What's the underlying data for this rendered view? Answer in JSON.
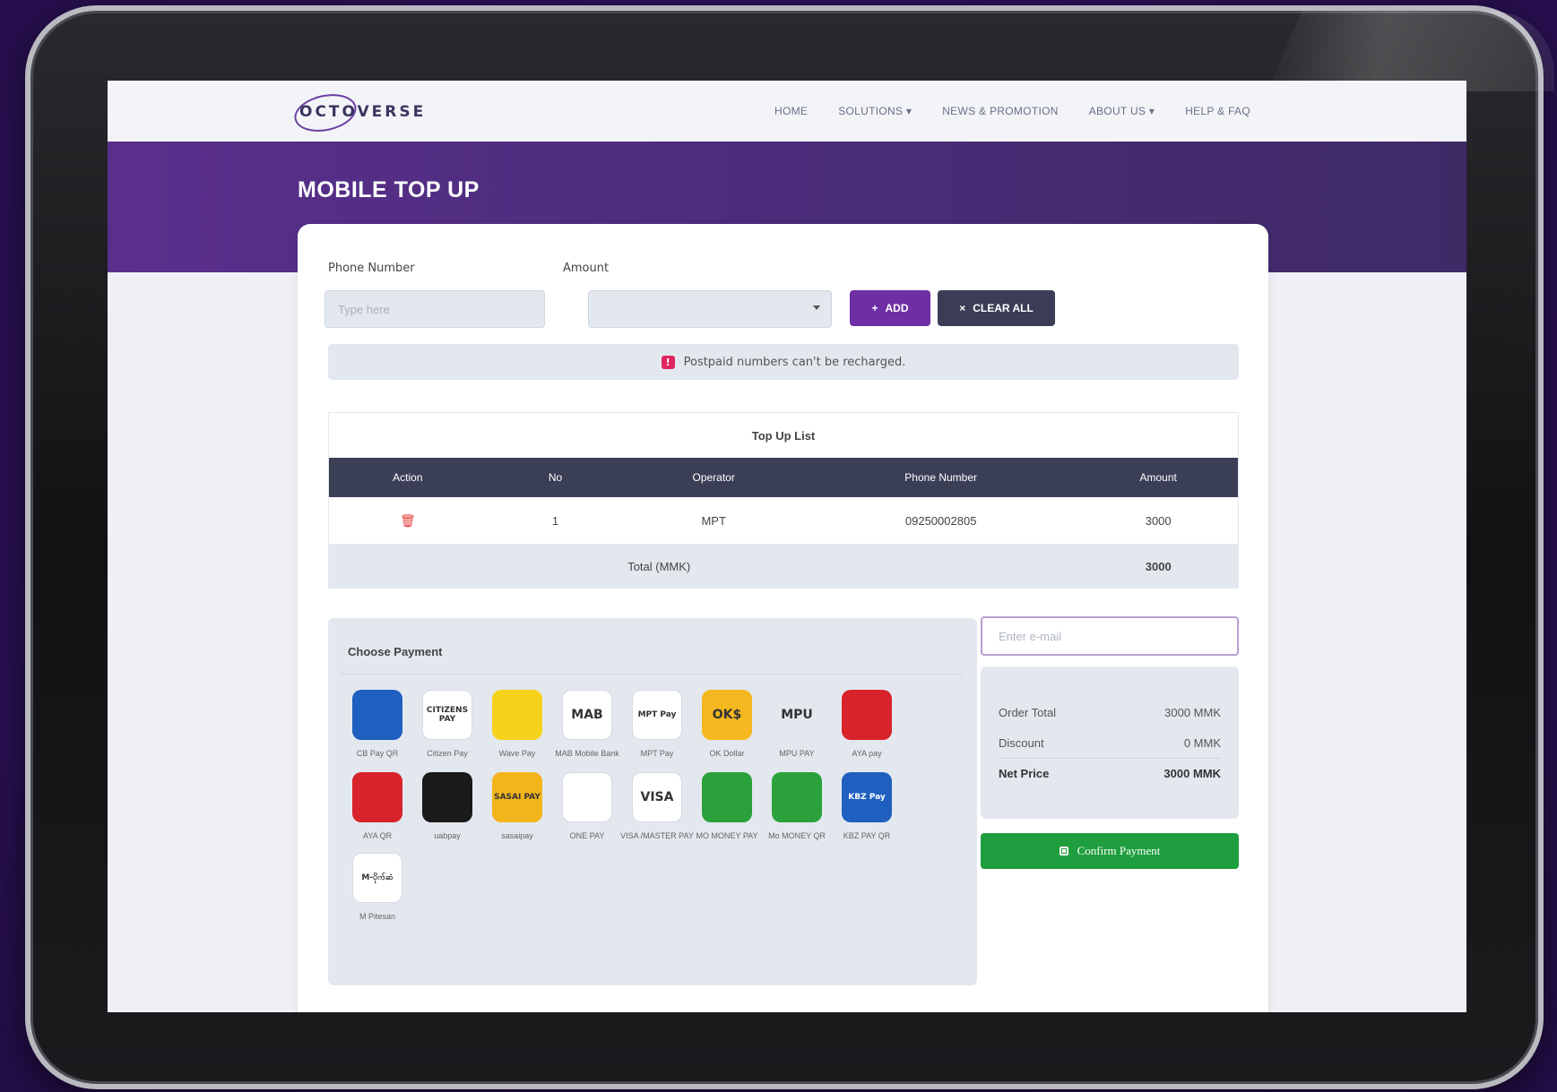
{
  "brand": {
    "name": "OCTOVERSE"
  },
  "nav": [
    {
      "label": "HOME"
    },
    {
      "label": "SOLUTIONS ▾"
    },
    {
      "label": "NEWS & PROMOTION"
    },
    {
      "label": "ABOUT US ▾"
    },
    {
      "label": "HELP & FAQ"
    }
  ],
  "page": {
    "title": "MOBILE TOP UP"
  },
  "form": {
    "phone_label": "Phone Number",
    "phone_placeholder": "Type here",
    "amount_label": "Amount",
    "add_label": "ADD",
    "clear_label": "CLEAR ALL",
    "add_icon": "+",
    "clear_icon": "×"
  },
  "alert": {
    "icon": "!",
    "text": "Postpaid numbers can't be recharged."
  },
  "topup_list": {
    "title": "Top Up List",
    "columns": [
      "Action",
      "No",
      "Operator",
      "Phone Number",
      "Amount"
    ],
    "rows": [
      {
        "no": "1",
        "operator": "MPT",
        "phone": "09250002805",
        "amount": "3000"
      }
    ],
    "total_label": "Total (MMK)",
    "total_value": "3000"
  },
  "payment": {
    "title": "Choose Payment",
    "methods": [
      {
        "label": "CB Pay QR",
        "icon_text": "",
        "color": "#1f5fbf"
      },
      {
        "label": "Citizen Pay",
        "icon_text": "CITIZENS PAY",
        "color": "#ffffff"
      },
      {
        "label": "Wave Pay",
        "icon_text": "",
        "color": "#f5d31c"
      },
      {
        "label": "MAB Mobile Bank",
        "icon_text": "MAB",
        "color": "#ffffff"
      },
      {
        "label": "MPT Pay",
        "icon_text": "MPT Pay",
        "color": "#ffffff"
      },
      {
        "label": "OK Dollar",
        "icon_text": "OK$",
        "color": "#f5b820"
      },
      {
        "label": "MPU PAY",
        "icon_text": "MPU",
        "color": "#e3e8ef"
      },
      {
        "label": "AYA pay",
        "icon_text": "",
        "color": "#d8232a"
      },
      {
        "label": "AYA QR",
        "icon_text": "",
        "color": "#d8232a"
      },
      {
        "label": "uabpay",
        "icon_text": "",
        "color": "#1a1a1a"
      },
      {
        "label": "sasaipay",
        "icon_text": "SASAI PAY",
        "color": "#f2b51b"
      },
      {
        "label": "ONE PAY",
        "icon_text": "",
        "color": "#ffffff"
      },
      {
        "label": "VISA /MASTER PAY",
        "icon_text": "VISA",
        "color": "#ffffff"
      },
      {
        "label": "MO MONEY PAY",
        "icon_text": "",
        "color": "#2aa13a"
      },
      {
        "label": "Mo MONEY QR",
        "icon_text": "",
        "color": "#2aa13a"
      },
      {
        "label": "KBZ PAY QR",
        "icon_text": "KBZ Pay",
        "color": "#1f5fbf"
      },
      {
        "label": "M Pitesan",
        "icon_text": "M-ပိုက်ဆံ",
        "color": "#ffffff"
      }
    ]
  },
  "checkout": {
    "email_placeholder": "Enter e-mail",
    "order_total_label": "Order Total",
    "order_total_value": "3000 MMK",
    "discount_label": "Discount",
    "discount_value": "0 MMK",
    "net_price_label": "Net Price",
    "net_price_value": "3000 MMK",
    "confirm_label": "Confirm Payment"
  }
}
